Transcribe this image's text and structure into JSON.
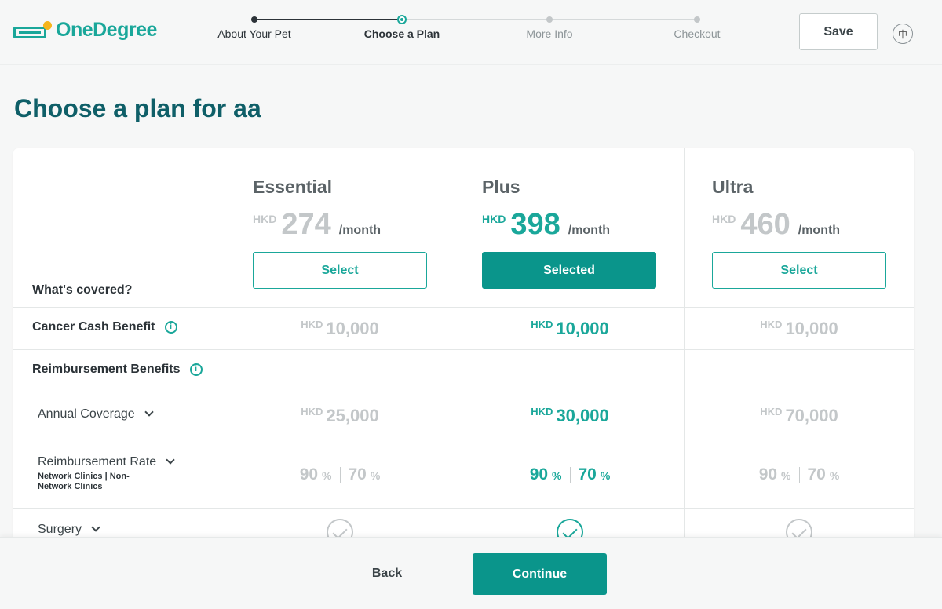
{
  "header": {
    "logo_text": "OneDegree",
    "steps": [
      {
        "label": "About Your Pet",
        "state": "done"
      },
      {
        "label": "Choose a Plan",
        "state": "current"
      },
      {
        "label": "More Info",
        "state": "upcoming"
      },
      {
        "label": "Checkout",
        "state": "upcoming"
      }
    ],
    "save_label": "Save",
    "lang_label": "中"
  },
  "page_title": "Choose a plan for aa",
  "table": {
    "covered_heading": "What's covered?",
    "plans": [
      {
        "name": "Essential",
        "currency": "HKD",
        "price": "274",
        "period": "/month",
        "button": "Select",
        "selected": false
      },
      {
        "name": "Plus",
        "currency": "HKD",
        "price": "398",
        "period": "/month",
        "button": "Selected",
        "selected": true
      },
      {
        "name": "Ultra",
        "currency": "HKD",
        "price": "460",
        "period": "/month",
        "button": "Select",
        "selected": false
      }
    ],
    "rows": {
      "cancer": {
        "label": "Cancer Cash Benefit",
        "currency": "HKD",
        "values": [
          "10,000",
          "10,000",
          "10,000"
        ]
      },
      "reimbursement": {
        "label": "Reimbursement Benefits"
      },
      "annual": {
        "label": "Annual Coverage",
        "currency": "HKD",
        "values": [
          "25,000",
          "30,000",
          "70,000"
        ]
      },
      "rate": {
        "label": "Reimbursement Rate",
        "note": "Network Clinics | Non-Network Clinics",
        "percent": "%",
        "values": [
          [
            "90",
            "70"
          ],
          [
            "90",
            "70"
          ],
          [
            "90",
            "70"
          ]
        ]
      },
      "surgery": {
        "label": "Surgery",
        "included": [
          true,
          true,
          true
        ]
      }
    }
  },
  "footer": {
    "back_label": "Back",
    "continue_label": "Continue"
  },
  "colors": {
    "brand": "#1aa79a",
    "brand_dark": "#0a958b",
    "title": "#0f5f68",
    "logo_dot": "#f6b51c"
  }
}
